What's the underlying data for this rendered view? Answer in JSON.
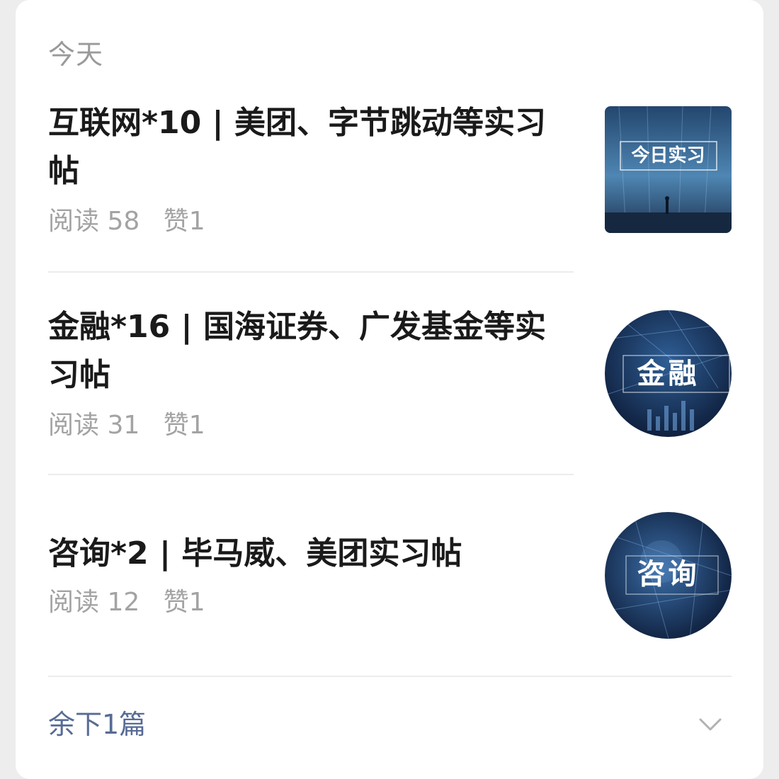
{
  "section_label": "今天",
  "articles": [
    {
      "title": "互联网*10 | 美团、字节跳动等实习帖",
      "reads_label": "阅读",
      "reads": "58",
      "likes_label": "赞",
      "likes": "1",
      "thumbnail_text": "今日实习",
      "thumbnail_icon": "internship-cover-image"
    },
    {
      "title": "金融*16 | 国海证券、广发基金等实习帖",
      "reads_label": "阅读",
      "reads": "31",
      "likes_label": "赞",
      "likes": "1",
      "thumbnail_text": "金融",
      "thumbnail_icon": "finance-cover-image"
    },
    {
      "title": "咨询*2 | 毕马威、美团实习帖",
      "reads_label": "阅读",
      "reads": "12",
      "likes_label": "赞",
      "likes": "1",
      "thumbnail_text": "咨询",
      "thumbnail_icon": "consulting-cover-image"
    }
  ],
  "footer": {
    "remaining_label": "余下1篇",
    "expand_icon": "chevron-down-icon"
  },
  "colors": {
    "link": "#576b95",
    "meta": "#a3a3a3",
    "title": "#1a1a1a"
  }
}
